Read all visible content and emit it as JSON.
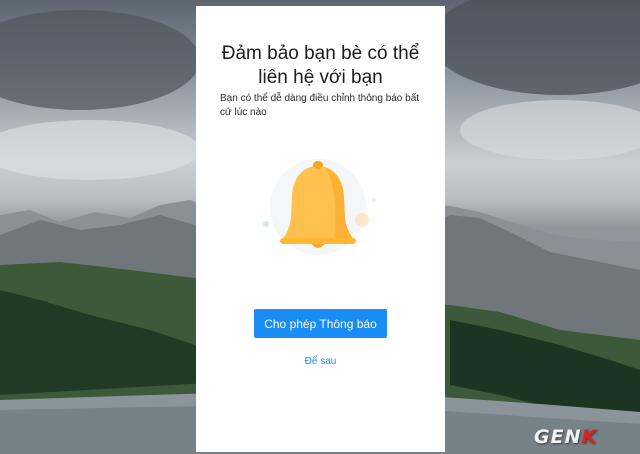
{
  "dialog": {
    "title_line1": "Đảm bảo bạn bè có thể",
    "title_line2": "liên hệ với bạn",
    "subtitle": "Bạn có thể dễ dàng điều chỉnh thông báo bất cứ lúc nào",
    "illustration_icon": "bell-icon",
    "allow_button_label": "Cho phép Thông báo",
    "later_label": "Để sau"
  },
  "watermark": {
    "text_main": "GEN",
    "text_accent": "K"
  },
  "colors": {
    "primary": "#1a8cf5",
    "bell": "#ffc14d",
    "bell_shadow": "#f5a623",
    "dialog_bg": "#ffffff"
  }
}
